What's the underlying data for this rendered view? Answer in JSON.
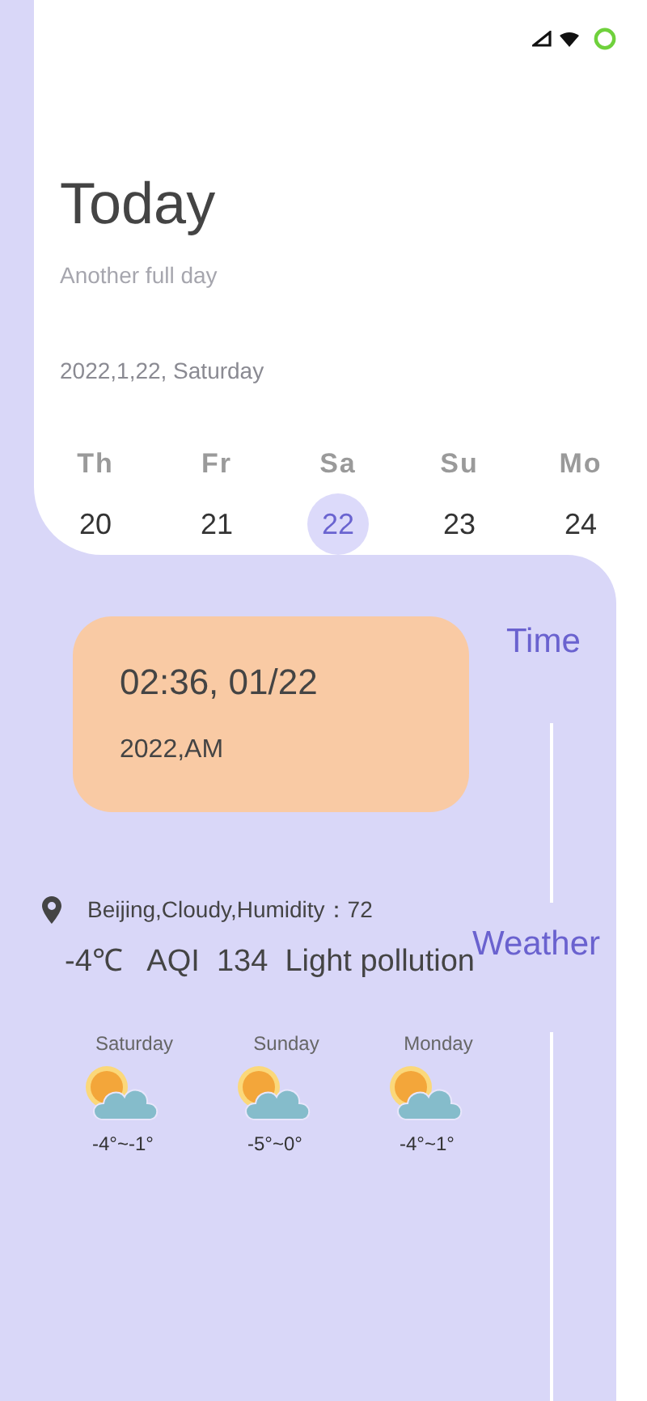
{
  "header": {
    "title": "Today",
    "subtitle": "Another full day",
    "date": "2022,1,22,  Saturday"
  },
  "week": [
    {
      "weekday": "Th",
      "day": "20",
      "selected": false
    },
    {
      "weekday": "Fr",
      "day": "21",
      "selected": false
    },
    {
      "weekday": "Sa",
      "day": "22",
      "selected": true
    },
    {
      "weekday": "Su",
      "day": "23",
      "selected": false
    },
    {
      "weekday": "Mo",
      "day": "24",
      "selected": false
    }
  ],
  "time_card": {
    "time": "02:36,  01/22",
    "year": "2022,AM"
  },
  "timeline": [
    "Time",
    "Weather"
  ],
  "weather": {
    "summary": "Beijing,Cloudy,Humidity：72",
    "details": "-4℃   AQI  134  Light pollution",
    "forecast": [
      {
        "day": "Saturday",
        "range": "-4°~-1°"
      },
      {
        "day": "Sunday",
        "range": "-5°~0°"
      },
      {
        "day": "Monday",
        "range": "-4°~1°"
      }
    ]
  }
}
